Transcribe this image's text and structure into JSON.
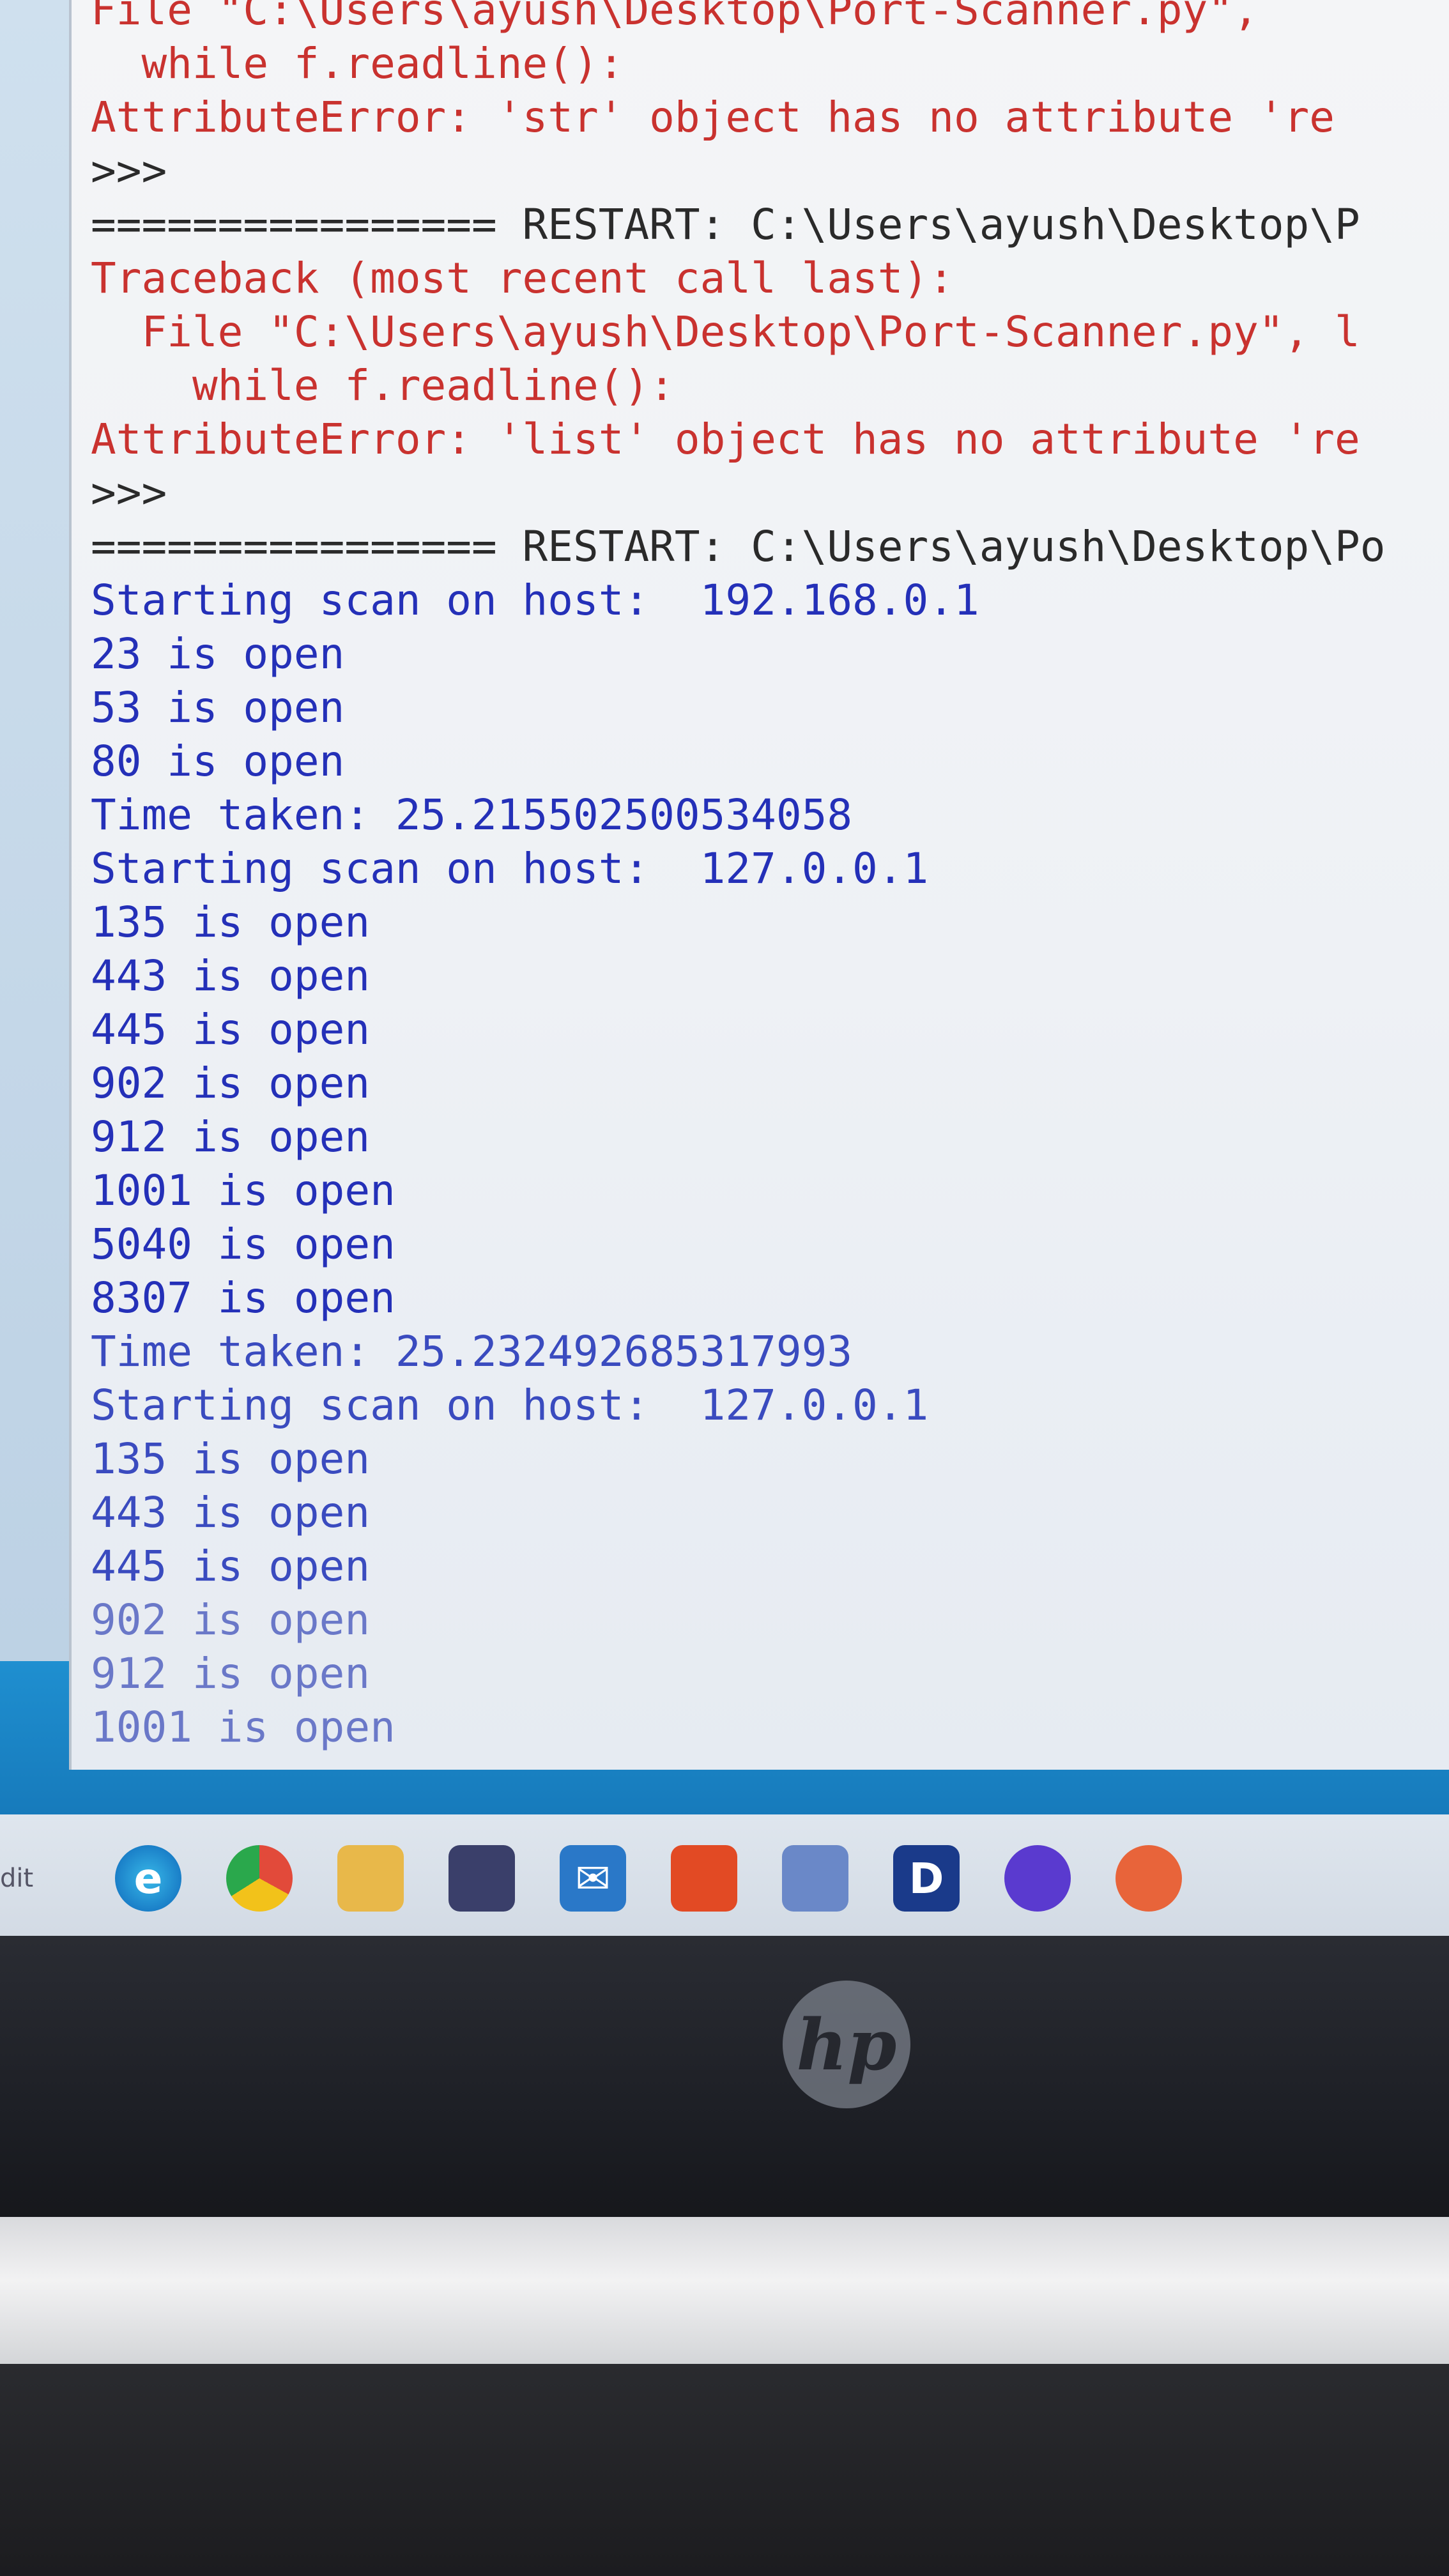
{
  "shell": {
    "lines": [
      {
        "text": "File \"C:\\Users\\ayush\\Desktop\\Port-Scanner.py\",",
        "kind": "err"
      },
      {
        "text": "  while f.readline():",
        "kind": "err"
      },
      {
        "text": "AttributeError: 'str' object has no attribute 're",
        "kind": "err"
      },
      {
        "text": ">>>",
        "kind": "prm"
      },
      {
        "text": "================ RESTART: C:\\Users\\ayush\\Desktop\\P",
        "kind": "restart"
      },
      {
        "text": "Traceback (most recent call last):",
        "kind": "err"
      },
      {
        "text": "  File \"C:\\Users\\ayush\\Desktop\\Port-Scanner.py\", l",
        "kind": "err"
      },
      {
        "text": "    while f.readline():",
        "kind": "err"
      },
      {
        "text": "AttributeError: 'list' object has no attribute 're",
        "kind": "err"
      },
      {
        "text": ">>>",
        "kind": "prm"
      },
      {
        "text": "================ RESTART: C:\\Users\\ayush\\Desktop\\Po",
        "kind": "restart"
      },
      {
        "text": "Starting scan on host:  192.168.0.1",
        "kind": "out"
      },
      {
        "text": "23 is open",
        "kind": "out"
      },
      {
        "text": "53 is open",
        "kind": "out"
      },
      {
        "text": "80 is open",
        "kind": "out"
      },
      {
        "text": "Time taken: 25.215502500534058",
        "kind": "out"
      },
      {
        "text": "Starting scan on host:  127.0.0.1",
        "kind": "out"
      },
      {
        "text": "135 is open",
        "kind": "out"
      },
      {
        "text": "443 is open",
        "kind": "out"
      },
      {
        "text": "445 is open",
        "kind": "out"
      },
      {
        "text": "902 is open",
        "kind": "out"
      },
      {
        "text": "912 is open",
        "kind": "out"
      },
      {
        "text": "1001 is open",
        "kind": "out"
      },
      {
        "text": "5040 is open",
        "kind": "out"
      },
      {
        "text": "8307 is open",
        "kind": "out"
      },
      {
        "text": "Time taken: 25.232492685317993",
        "kind": "dim"
      },
      {
        "text": "Starting scan on host:  127.0.0.1",
        "kind": "dim"
      },
      {
        "text": "135 is open",
        "kind": "dim"
      },
      {
        "text": "443 is open",
        "kind": "dim"
      },
      {
        "text": "445 is open",
        "kind": "dim"
      },
      {
        "text": "902 is open",
        "kind": "faint"
      },
      {
        "text": "912 is open",
        "kind": "faint"
      },
      {
        "text": "1001 is open",
        "kind": "faint"
      }
    ]
  },
  "taskbar": {
    "left_label": "dit",
    "icons": [
      {
        "name": "edge-icon",
        "cls": "edge",
        "glyph": "e"
      },
      {
        "name": "chrome-icon",
        "cls": "chrome",
        "glyph": ""
      },
      {
        "name": "file-explorer-icon",
        "cls": "files",
        "glyph": ""
      },
      {
        "name": "store-icon",
        "cls": "store",
        "glyph": ""
      },
      {
        "name": "mail-icon",
        "cls": "mail",
        "glyph": "✉"
      },
      {
        "name": "office-icon",
        "cls": "office",
        "glyph": ""
      },
      {
        "name": "folder-icon",
        "cls": "folder2",
        "glyph": ""
      },
      {
        "name": "app-d-icon",
        "cls": "dev",
        "glyph": "D"
      },
      {
        "name": "github-icon",
        "cls": "github",
        "glyph": ""
      },
      {
        "name": "app-icon",
        "cls": "app",
        "glyph": ""
      }
    ]
  },
  "device": {
    "logo": "hp"
  }
}
